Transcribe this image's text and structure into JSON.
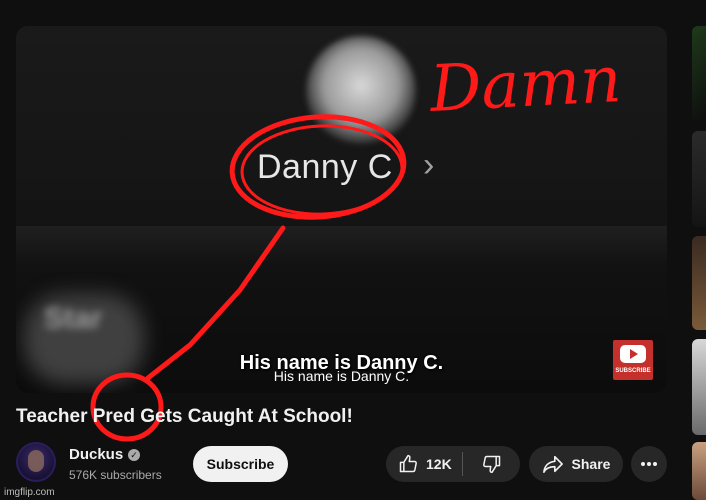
{
  "video": {
    "overlay_contact_name": "Danny C",
    "caption_big": "His name is Danny C.",
    "caption_small": "His name is Danny C.",
    "subscribe_badge_text": "SUBSCRIBE",
    "blurred_text": "Star"
  },
  "annotation": {
    "text": "Damn",
    "color": "#ff1a1a"
  },
  "title": "Teacher Pred Gets Caught At School!",
  "channel": {
    "name": "Duckus",
    "subscribers": "576K subscribers"
  },
  "actions": {
    "subscribe_label": "Subscribe",
    "like_count": "12K",
    "share_label": "Share"
  },
  "watermark": "imgflip.com",
  "colors": {
    "background": "#0f0f0f",
    "pill": "#272727",
    "subscribe_bg": "#f1f1f1",
    "badge_red": "#c4302b"
  }
}
